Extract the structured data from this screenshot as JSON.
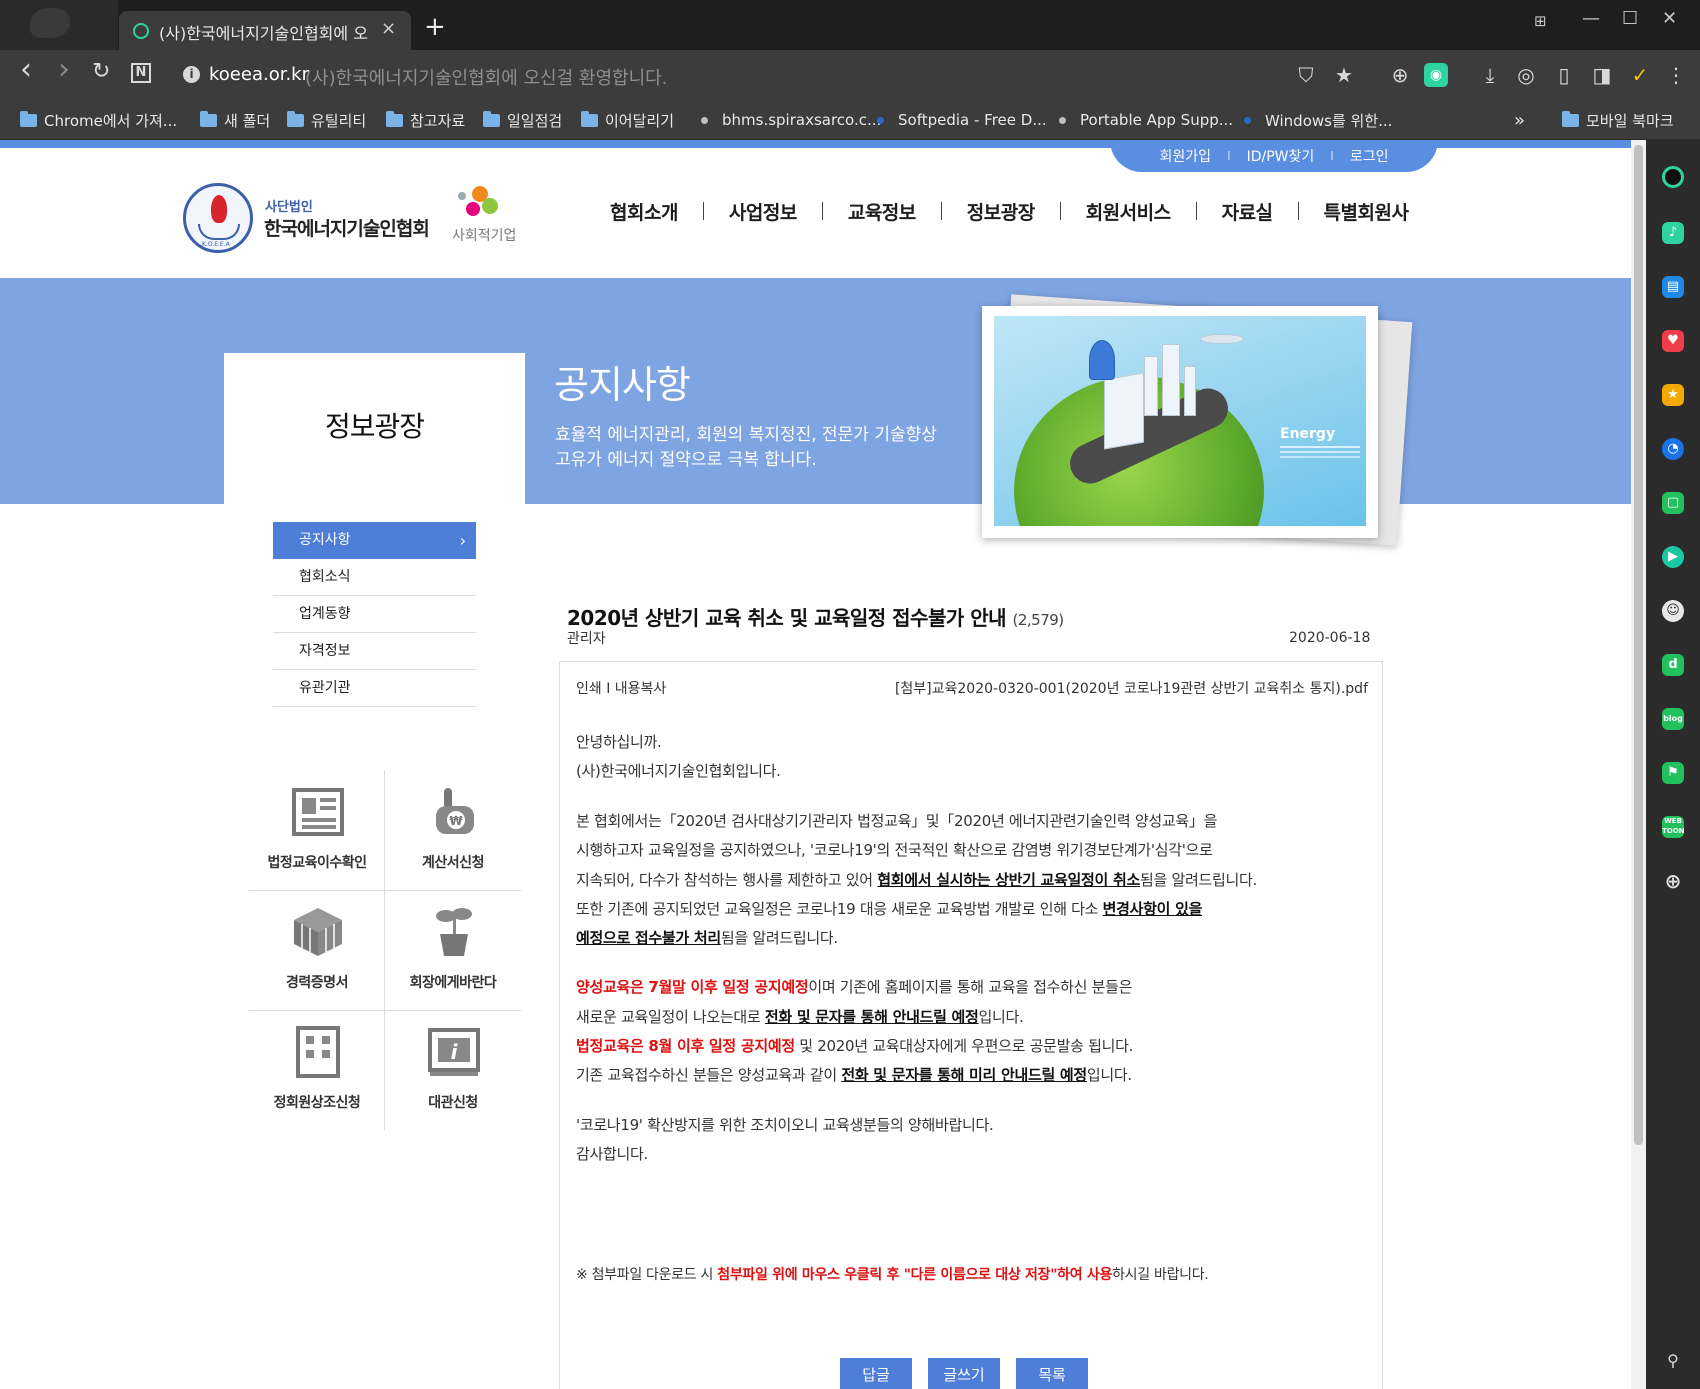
{
  "browser": {
    "tab_title": "(사)한국에너지기술인협회에 오신걸 환영합니다.",
    "tab_close": "×",
    "new_tab": "+",
    "url_host": "koeea.or.kr",
    "url_rest": "(사)한국에너지기술인협회에 오신걸 환영합니다.",
    "window_controls": {
      "grid": "⊞",
      "minimize": "—",
      "maximize": "☐",
      "close": "✕"
    },
    "nav_icons": {
      "back": "‹",
      "forward": "›",
      "reload": "↻",
      "notion": "N"
    },
    "bookmarks": [
      {
        "label": "Chrome에서 가져...",
        "type": "folder"
      },
      {
        "label": "새 폴더",
        "type": "folder"
      },
      {
        "label": "유틸리티",
        "type": "folder"
      },
      {
        "label": "참고자료",
        "type": "folder"
      },
      {
        "label": "일일점검",
        "type": "folder"
      },
      {
        "label": "이어달리기",
        "type": "folder"
      },
      {
        "label": "bhms.spiraxsarco.c...",
        "type": "page"
      },
      {
        "label": "Softpedia - Free D...",
        "type": "page"
      },
      {
        "label": "Portable App Supp...",
        "type": "page"
      },
      {
        "label": "Windows를 위한...",
        "type": "page"
      }
    ],
    "bookmarks_more": "»",
    "mobile_bookmarks": "모바일 북마크"
  },
  "site": {
    "util_links": [
      "회원가입",
      "ID/PW찾기",
      "로그인"
    ],
    "util_sep": "I",
    "logo_sub": "사단법인",
    "logo_main": "한국에너지기술인협회",
    "logo_emblem_text": "K.O.E.E.A",
    "social_enterprise": "사회적기업",
    "gnb": [
      "협회소개",
      "사업정보",
      "교육정보",
      "정보광장",
      "회원서비스",
      "자료실",
      "특별회원사"
    ],
    "section_title": "정보광장",
    "visual_title": "공지사항",
    "visual_desc": [
      "효율적 에너지관리, 회원의 복지정진, 전문가 기술향상",
      "고유가 에너지 절약으로 극복 합니다."
    ],
    "visual_photo_caption": "Energy",
    "side_menu": [
      {
        "label": "공지사항",
        "active": true
      },
      {
        "label": "협회소식",
        "active": false
      },
      {
        "label": "업계동향",
        "active": false
      },
      {
        "label": "자격정보",
        "active": false
      },
      {
        "label": "유관기관",
        "active": false
      }
    ],
    "side_menu_chevron": "›",
    "quick_links": [
      "법정교육이수확인",
      "계산서신청",
      "경력증명서",
      "회장에게바란다",
      "정회원상조신청",
      "대관신청"
    ]
  },
  "article": {
    "title": "2020년 상반기 교육 취소 및 교육일정 접수불가 안내",
    "views": "(2,579)",
    "author": "관리자",
    "date": "2020-06-18",
    "tools": "인쇄 I 내용복사",
    "attachment": "[첨부]교육2020-0320-001(2020년 코로나19관련 상반기 교육취소 통지).pdf",
    "greeting1": "안녕하십니까.",
    "greeting2": "(사)한국에너지기술인협회입니다.",
    "p1_l1": "본 협회에서는「2020년 검사대상기기관리자 법정교육」및「2020년 에너지관련기술인력 양성교육」을",
    "p1_l2": "시행하고자 교육일정을 공지하였으나, '코로나19'의 전국적인 확산으로 감염병 위기경보단계가'심각'으로",
    "p1_l3a": "지속되어, 다수가 참석하는 행사를 제한하고 있어 ",
    "p1_l3b": "협회에서 실시하는 상반기 교육일정이 취소",
    "p1_l3c": "됨을 알려드립니다.",
    "p1_l4a": "또한 기존에 공지되었던 교육일정은 코로나19 대응 새로운 교육방법 개발로 인해 다소 ",
    "p1_l4b": "변경사항이 있을",
    "p1_l5a": "예정으로  접수불가 처리",
    "p1_l5b": "됨을 알려드립니다.",
    "p2_l1a": "양성교육은 7월말 이후 일정 공지예정",
    "p2_l1b": "이며 기존에 홈페이지를 통해 교육을 접수하신 분들은",
    "p2_l2a": "새로운 교육일정이 나오는대로 ",
    "p2_l2b": "전화 및 문자를 통해 안내드릴 예정",
    "p2_l2c": "입니다.",
    "p2_l3a": "법정교육은 8월 이후  일정 공지예정",
    "p2_l3b": " 및 2020년 교육대상자에게 우편으로 공문발송 됩니다.",
    "p2_l4a": "기존 교육접수하신 분들은 양성교육과 같이  ",
    "p2_l4b": "전화 및 문자를 통해 미리 안내드릴 예정",
    "p2_l4c": "입니다.",
    "p3_l1": "'코로나19' 확산방지를 위한 조치이오니 교육생분들의 양해바랍니다.",
    "p3_l2": "감사합니다.",
    "note_a": "※ 첨부파일 다운로드 시 ",
    "note_b": "첨부파일 위에 마우스 우클릭 후 \"다른 이름으로 대상 저장\"하여 사용",
    "note_c": "하시길 바랍니다.",
    "buttons": [
      "답글",
      "글쓰기",
      "목록"
    ]
  },
  "colors": {
    "accent": "#4f7ed8",
    "visual_bg": "#7ea4e2",
    "highlight_red": "#e01010"
  }
}
